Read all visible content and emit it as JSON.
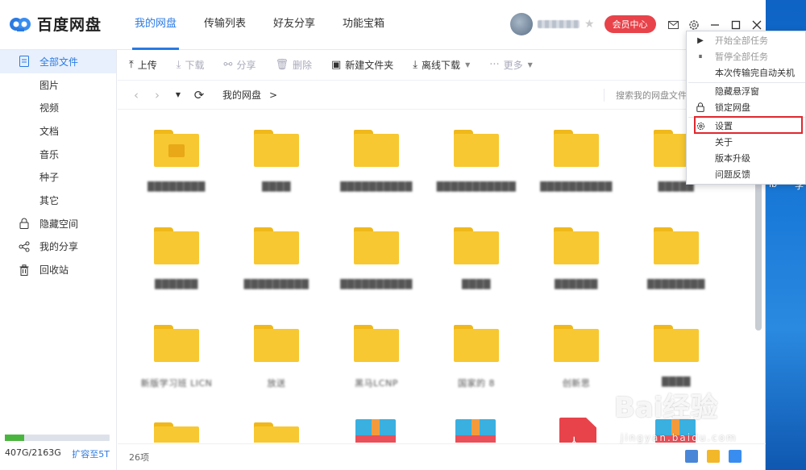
{
  "app": {
    "name": "百度网盘"
  },
  "nav": {
    "tabs": [
      "我的网盘",
      "传输列表",
      "好友分享",
      "功能宝箱"
    ],
    "active": 0
  },
  "header": {
    "vip_label": "会员中心"
  },
  "sidebar": {
    "items": [
      {
        "label": "全部文件",
        "icon": "file-icon",
        "active": true,
        "sub": false
      },
      {
        "label": "图片",
        "sub": true
      },
      {
        "label": "视频",
        "sub": true
      },
      {
        "label": "文档",
        "sub": true
      },
      {
        "label": "音乐",
        "sub": true
      },
      {
        "label": "种子",
        "sub": true
      },
      {
        "label": "其它",
        "sub": true
      },
      {
        "label": "隐藏空间",
        "icon": "lock-icon",
        "sub": false
      },
      {
        "label": "我的分享",
        "icon": "share-icon",
        "sub": false
      },
      {
        "label": "回收站",
        "icon": "trash-icon",
        "sub": false
      }
    ],
    "storage": {
      "used_text": "407G/2163G",
      "expand_label": "扩容至5T",
      "used_fraction": 0.188
    }
  },
  "toolbar": {
    "upload": "上传",
    "download": "下载",
    "share": "分享",
    "delete": "删除",
    "new_folder": "新建文件夹",
    "offline": "离线下载",
    "more": "更多"
  },
  "address": {
    "crumb": "我的网盘",
    "sep": ">",
    "search_placeholder": "搜索我的网盘文件"
  },
  "files": [
    {
      "type": "folder-lock",
      "name": "████████"
    },
    {
      "type": "folder",
      "name": "████"
    },
    {
      "type": "folder",
      "name": "██████████"
    },
    {
      "type": "folder",
      "name": "███████████"
    },
    {
      "type": "folder",
      "name": "██████████"
    },
    {
      "type": "folder",
      "name": "█████"
    },
    {
      "type": "folder",
      "name": "██████"
    },
    {
      "type": "folder",
      "name": "█████████"
    },
    {
      "type": "folder",
      "name": "██████████"
    },
    {
      "type": "folder",
      "name": "████"
    },
    {
      "type": "folder",
      "name": "██████"
    },
    {
      "type": "folder",
      "name": "████████"
    },
    {
      "type": "folder",
      "name": "新版学习班 LICN"
    },
    {
      "type": "folder",
      "name": "放送"
    },
    {
      "type": "folder",
      "name": "黑马LCNP"
    },
    {
      "type": "folder",
      "name": "国家的 8"
    },
    {
      "type": "folder",
      "name": "创新思"
    },
    {
      "type": "folder",
      "name": "████"
    },
    {
      "type": "folder",
      "name": ""
    },
    {
      "type": "folder",
      "name": ""
    },
    {
      "type": "zip",
      "name": ""
    },
    {
      "type": "zip",
      "name": ""
    },
    {
      "type": "pdf",
      "name": ""
    },
    {
      "type": "zip",
      "name": ""
    }
  ],
  "status": {
    "count": "26项"
  },
  "menu": {
    "items": [
      {
        "label": "开始全部任务",
        "dim": true,
        "icon": "play-icon"
      },
      {
        "label": "暂停全部任务",
        "dim": true,
        "icon": "pause-icon"
      },
      {
        "label": "本次传输完自动关机",
        "dim": false,
        "icon": ""
      },
      {
        "label": "隐藏悬浮窗",
        "dim": false,
        "icon": ""
      },
      {
        "label": "锁定网盘",
        "dim": false,
        "icon": "lock-icon"
      },
      {
        "label": "设置",
        "dim": false,
        "icon": "settings-icon"
      },
      {
        "label": "关于",
        "dim": false,
        "icon": ""
      },
      {
        "label": "版本升级",
        "dim": false,
        "icon": ""
      },
      {
        "label": "问题反馈",
        "dim": false,
        "icon": ""
      }
    ]
  },
  "desktop": {
    "text1": "ib",
    "text2": "学"
  },
  "watermark": {
    "main": "Bai经验",
    "sub": "jingyan.baidu.com"
  },
  "colors": {
    "accent": "#2a7ae2",
    "vip": "#e8434a",
    "folder": "#f7c831",
    "highlight": "#e0282e"
  }
}
